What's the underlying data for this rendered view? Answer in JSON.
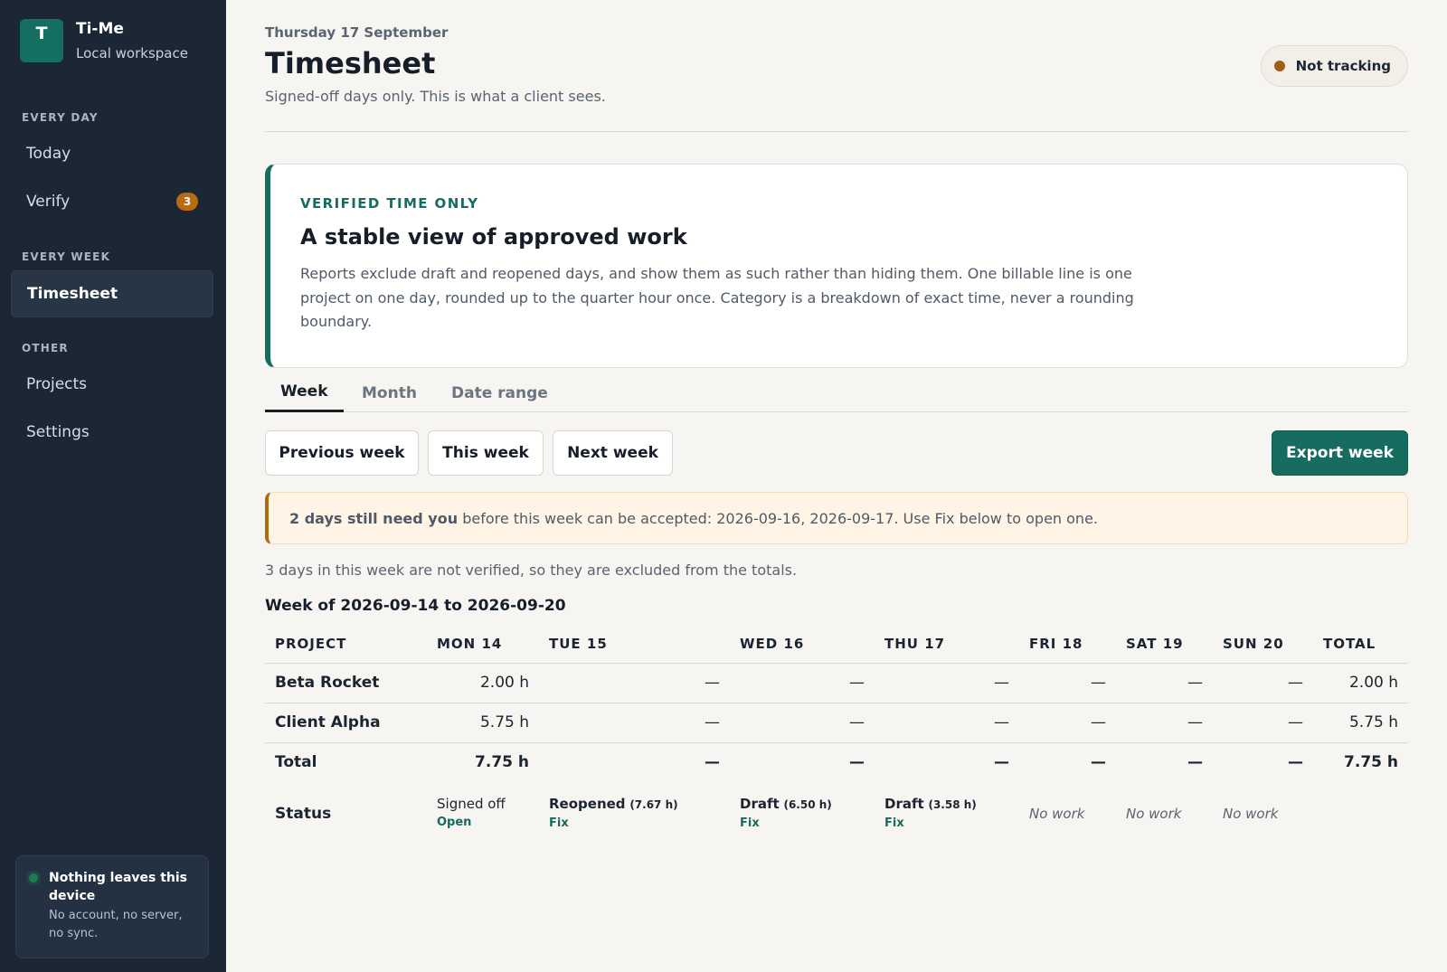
{
  "sidebar": {
    "logo_letter": "T",
    "app_name": "Ti-Me",
    "workspace": "Local workspace",
    "sections": {
      "every_day": "EVERY DAY",
      "every_week": "EVERY WEEK",
      "other": "OTHER"
    },
    "items": {
      "today": "Today",
      "verify": "Verify",
      "verify_badge": "3",
      "timesheet": "Timesheet",
      "projects": "Projects",
      "settings": "Settings"
    },
    "privacy": {
      "title": "Nothing leaves this device",
      "text": "No account, no server, no sync."
    }
  },
  "header": {
    "date": "Thursday 17 September",
    "title": "Timesheet",
    "subtitle": "Signed-off days only. This is what a client sees.",
    "tracking_status": "Not tracking"
  },
  "info_card": {
    "eyebrow": "VERIFIED TIME ONLY",
    "title": "A stable view of approved work",
    "text": "Reports exclude draft and reopened days, and show them as such rather than hiding them. One billable line is one project on one day, rounded up to the quarter hour once. Category is a breakdown of exact time, never a rounding boundary."
  },
  "tabs": {
    "week": "Week",
    "month": "Month",
    "range": "Date range",
    "active": "week"
  },
  "toolbar": {
    "previous": "Previous week",
    "this": "This week",
    "next": "Next week",
    "export": "Export week"
  },
  "warning": {
    "strong": "2 days still need you",
    "text": " before this week can be accepted: 2026-09-16, 2026-09-17. Use Fix below to open one."
  },
  "excluded_note": "3 days in this week are not verified, so they are excluded from the totals.",
  "week_title": "Week of 2026-09-14 to 2026-09-20",
  "table": {
    "headers": [
      "PROJECT",
      "MON 14",
      "TUE 15",
      "WED 16",
      "THU 17",
      "FRI 18",
      "SAT 19",
      "SUN 20",
      "TOTAL"
    ],
    "rows": [
      {
        "project": "Beta Rocket",
        "cells": [
          "2.00 h",
          "—",
          "—",
          "—",
          "—",
          "—",
          "—"
        ],
        "total": "2.00 h"
      },
      {
        "project": "Client Alpha",
        "cells": [
          "5.75 h",
          "—",
          "—",
          "—",
          "—",
          "—",
          "—"
        ],
        "total": "5.75 h"
      }
    ],
    "total_row": {
      "label": "Total",
      "cells": [
        "7.75 h",
        "—",
        "—",
        "—",
        "—",
        "—",
        "—"
      ],
      "total": "7.75 h"
    },
    "status_row": {
      "label": "Status",
      "mon": {
        "state": "Signed off",
        "link": "Open"
      },
      "tue": {
        "state": "Reopened",
        "hours": "(7.67 h)",
        "link": "Fix"
      },
      "wed": {
        "state": "Draft",
        "hours": "(6.50 h)",
        "link": "Fix"
      },
      "thu": {
        "state": "Draft",
        "hours": "(3.58 h)",
        "link": "Fix"
      },
      "fri": "No work",
      "sat": "No work",
      "sun": "No work"
    }
  },
  "colors": {
    "accent": "#156c5f",
    "sidebar": "#1c2735",
    "warning": "#b0690f"
  }
}
